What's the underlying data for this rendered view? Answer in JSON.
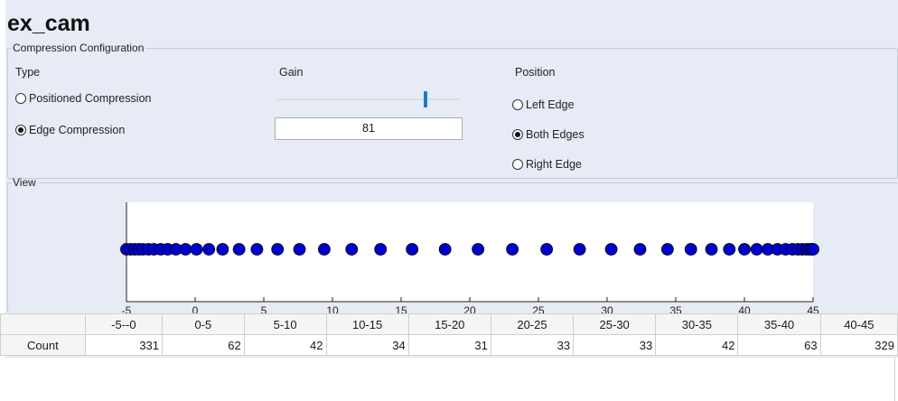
{
  "app": {
    "title": "ex_cam"
  },
  "config": {
    "legend": "Compression Configuration",
    "type_label": "Type",
    "gain_label": "Gain",
    "position_label": "Position",
    "type_options": [
      {
        "label": "Positioned Compression",
        "selected": false
      },
      {
        "label": "Edge Compression",
        "selected": true
      }
    ],
    "gain_value": "81",
    "gain_slider_value": 81,
    "gain_slider_range": [
      0,
      100
    ],
    "position_options": [
      {
        "label": "Left Edge",
        "selected": false
      },
      {
        "label": "Both Edges",
        "selected": true
      },
      {
        "label": "Right Edge",
        "selected": false
      }
    ],
    "colors": {
      "accent": "#1f7ac6"
    }
  },
  "view": {
    "legend": "View"
  },
  "chart_data": {
    "type": "scatter",
    "xlim": [
      -5,
      45
    ],
    "xticks": [
      "-5",
      "0",
      "5",
      "10",
      "15",
      "20",
      "25",
      "30",
      "35",
      "40",
      "45"
    ],
    "y": 0,
    "marker_color": "#0000cc",
    "marker_edge_color": "#000000",
    "x": [
      -5,
      -4.7,
      -4.4,
      -4.1,
      -3.8,
      -3.4,
      -3.0,
      -2.5,
      -2.0,
      -1.4,
      -0.7,
      0.1,
      1.0,
      2.0,
      3.2,
      4.5,
      6.0,
      7.6,
      9.4,
      11.4,
      13.5,
      15.8,
      18.2,
      20.6,
      23.1,
      25.6,
      28.0,
      30.3,
      32.4,
      34.4,
      36.1,
      37.6,
      38.9,
      40.0,
      40.9,
      41.7,
      42.4,
      43.0,
      43.5,
      43.9,
      44.2,
      44.5,
      44.7,
      44.9,
      45
    ]
  },
  "histogram": {
    "row_label": "Count",
    "columns": [
      "-5--0",
      "0-5",
      "5-10",
      "10-15",
      "15-20",
      "20-25",
      "25-30",
      "30-35",
      "35-40",
      "40-45"
    ],
    "counts": [
      "331",
      "62",
      "42",
      "34",
      "31",
      "33",
      "33",
      "42",
      "63",
      "329"
    ]
  }
}
